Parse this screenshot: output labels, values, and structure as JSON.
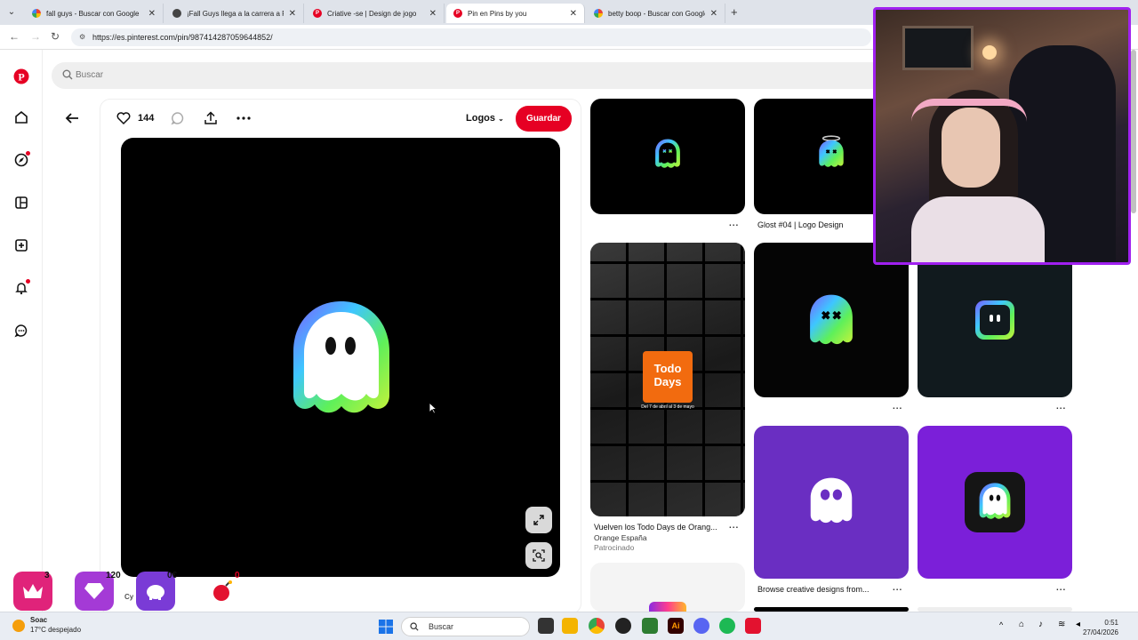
{
  "browser": {
    "tabs": [
      {
        "title": "fall guys - Buscar con Google",
        "favicon": "google-icon"
      },
      {
        "title": "¡Fall Guys llega a la carrera a Fo",
        "favicon": "page-icon"
      },
      {
        "title": "Criative -se | Design de jogo",
        "favicon": "pinterest-icon"
      },
      {
        "title": "Pin en Pins by you",
        "favicon": "pinterest-icon",
        "active": true
      },
      {
        "title": "betty boop - Buscar con Google",
        "favicon": "google-icon"
      }
    ],
    "url": "https://es.pinterest.com/pin/987414287059644852/"
  },
  "search": {
    "placeholder": "Buscar"
  },
  "pin": {
    "likes": "144",
    "board": "Logos",
    "save_label": "Guardar"
  },
  "grid": {
    "glost_caption": "Glost #04 | Logo Design",
    "todo_title": "Vuelven los Todo Days de Orang...",
    "todo_advertiser": "Orange España",
    "todo_sponsored": "Patrocinado",
    "todo_logo_line1": "Todo",
    "todo_logo_line2": "Days",
    "todo_dates": "Del 7 de abril al 3 de mayo",
    "browse_caption": "Browse creative designs from...",
    "more": "..."
  },
  "widgets": {
    "crown_count": "3",
    "gem_count": "120",
    "piggy_value": "0€",
    "bomb_count": "0",
    "cy_label": "Cy"
  },
  "taskbar": {
    "weather": "17°C despejado",
    "weather_short": "Soac",
    "search_placeholder": "Buscar",
    "time": "0:51",
    "date": "27/04/2026"
  },
  "colors": {
    "pinterest_red": "#e60023",
    "purple_tile": "#6a2ec2",
    "violet_tile": "#7b1fd9",
    "webcam_border": "#a020f0"
  }
}
